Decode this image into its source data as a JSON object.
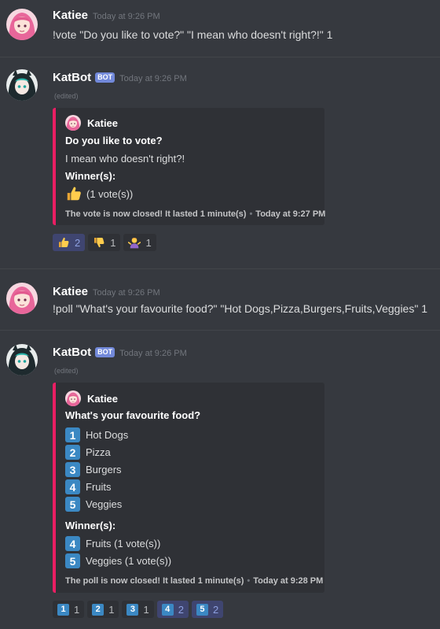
{
  "messages": [
    {
      "author": "Katiee",
      "timestamp": "Today at 9:26 PM",
      "text": "!vote \"Do you like to vote?\" \"I mean who doesn't right?!\" 1"
    },
    {
      "author": "KatBot",
      "bot_tag": "BOT",
      "timestamp": "Today at 9:26 PM",
      "edited": "(edited)",
      "embed": {
        "author": "Katiee",
        "title": "Do you like to vote?",
        "description": "I mean who doesn't right?!",
        "field_name": "Winner(s):",
        "winner_text": "(1 vote(s))",
        "footer_text": "The vote is now closed! It lasted 1 minute(s)",
        "footer_time": "Today at 9:27 PM"
      },
      "reactions": [
        {
          "emoji": "thumbs-up",
          "count": "2",
          "me": true
        },
        {
          "emoji": "thumbs-down",
          "count": "1",
          "me": false
        },
        {
          "emoji": "person-shrugging",
          "count": "1",
          "me": false
        }
      ]
    },
    {
      "author": "Katiee",
      "timestamp": "Today at 9:26 PM",
      "text": "!poll \"What's your favourite food?\" \"Hot Dogs,Pizza,Burgers,Fruits,Veggies\"  1"
    },
    {
      "author": "KatBot",
      "bot_tag": "BOT",
      "timestamp": "Today at 9:26 PM",
      "edited": "(edited)",
      "embed": {
        "author": "Katiee",
        "title": "What's your favourite food?",
        "options": [
          {
            "num": "1",
            "label": "Hot Dogs"
          },
          {
            "num": "2",
            "label": "Pizza"
          },
          {
            "num": "3",
            "label": "Burgers"
          },
          {
            "num": "4",
            "label": "Fruits"
          },
          {
            "num": "5",
            "label": "Veggies"
          }
        ],
        "field_name": "Winner(s):",
        "winners": [
          {
            "num": "4",
            "label": "Fruits (1 vote(s))"
          },
          {
            "num": "5",
            "label": "Veggies (1 vote(s))"
          }
        ],
        "footer_text": "The poll is now closed! It lasted 1 minute(s)",
        "footer_time": "Today at 9:28 PM"
      },
      "reactions": [
        {
          "num": "1",
          "count": "1",
          "me": false
        },
        {
          "num": "2",
          "count": "1",
          "me": false
        },
        {
          "num": "3",
          "count": "1",
          "me": false
        },
        {
          "num": "4",
          "count": "2",
          "me": true
        },
        {
          "num": "5",
          "count": "2",
          "me": true
        }
      ]
    }
  ],
  "colors": {
    "background": "#36393f",
    "embed_bg": "#2f3136",
    "embed_border": "#e91e63",
    "bot_tag": "#7289da",
    "keycap": "#3b88c3",
    "reaction_active": "#3f4570"
  }
}
